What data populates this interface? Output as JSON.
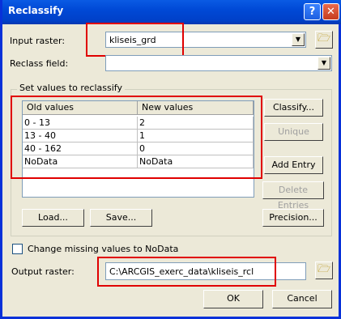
{
  "window": {
    "title": "Reclassify",
    "help_glyph": "?",
    "close_glyph": "✕"
  },
  "input_raster": {
    "label": "Input raster:",
    "value": "kliseis_grd"
  },
  "reclass_field": {
    "label": "Reclass field:",
    "value": ""
  },
  "group": {
    "title": "Set values to reclassify"
  },
  "table": {
    "columns": [
      "Old values",
      "New values"
    ],
    "rows": [
      {
        "old": "0 - 13",
        "new": "2"
      },
      {
        "old": "13 - 40",
        "new": "1"
      },
      {
        "old": "40 - 162",
        "new": "0"
      },
      {
        "old": "NoData",
        "new": "NoData"
      }
    ]
  },
  "buttons": {
    "classify": "Classify...",
    "unique": "Unique",
    "add_entry": "Add Entry",
    "delete_entries": "Delete Entries",
    "load": "Load...",
    "save": "Save...",
    "precision": "Precision...",
    "ok": "OK",
    "cancel": "Cancel"
  },
  "change_missing": {
    "label": "Change missing values to NoData",
    "checked": false
  },
  "output_raster": {
    "label": "Output raster:",
    "value": "C:\\ARCGIS_exerc_data\\kliseis_rcl"
  },
  "icons": {
    "folder": "folder-open-icon",
    "dropdown": "chevron-down-icon"
  },
  "colors": {
    "title_bar": "#0049d6",
    "highlight_box": "#e00000",
    "dialog_bg": "#ece9d8"
  }
}
